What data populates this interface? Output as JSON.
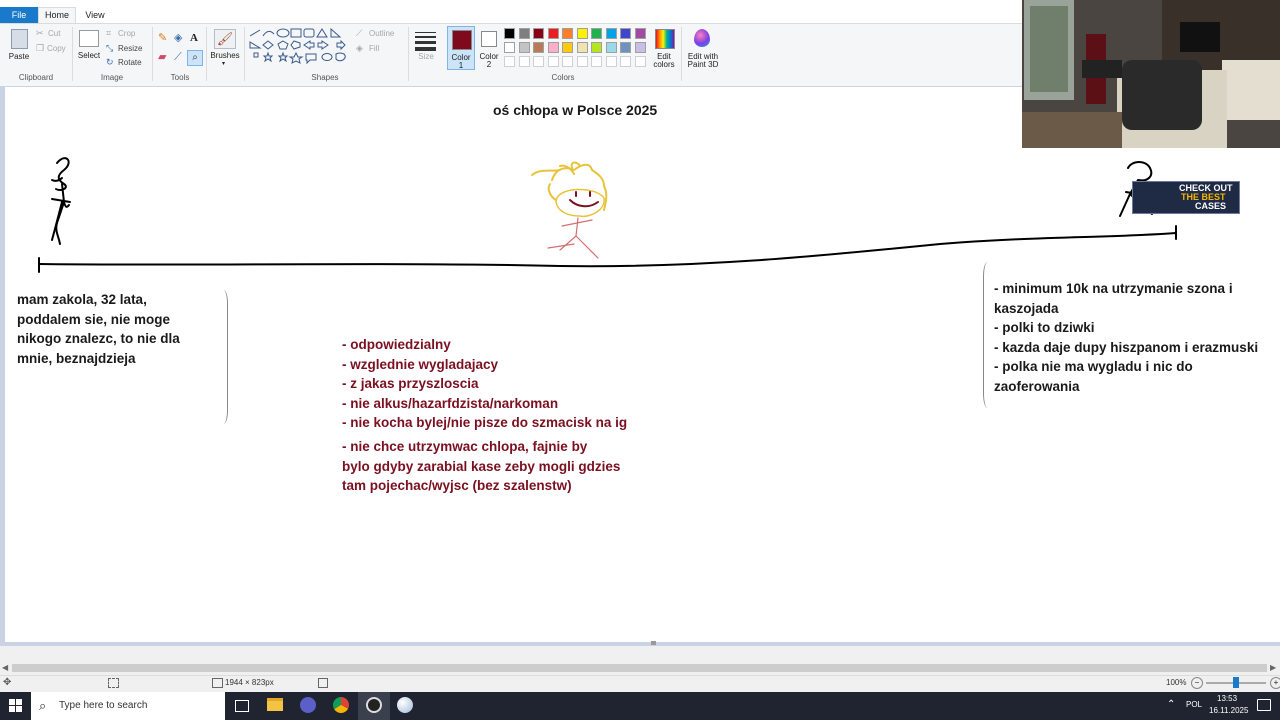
{
  "title_tabs": {
    "file": "File",
    "home": "Home",
    "view": "View"
  },
  "ribbon": {
    "clipboard": {
      "paste": "Paste",
      "cut": "Cut",
      "copy": "Copy",
      "label": "Clipboard"
    },
    "image": {
      "select": "Select",
      "crop": "Crop",
      "resize": "Resize",
      "rotate": "Rotate",
      "label": "Image"
    },
    "tools": {
      "label": "Tools"
    },
    "brushes": {
      "label": "Brushes"
    },
    "shapes": {
      "outline": "Outline",
      "fill": "Fill",
      "label": "Shapes"
    },
    "size": {
      "label": "Size"
    },
    "color1": {
      "label1": "Color",
      "label2": "1",
      "value": "#7f0a1e"
    },
    "color2": {
      "label1": "Color",
      "label2": "2",
      "value": "#ffffff"
    },
    "colors": {
      "label": "Colors"
    },
    "edit_colors": {
      "label1": "Edit",
      "label2": "colors"
    },
    "paint3d": {
      "label1": "Edit with",
      "label2": "Paint 3D"
    },
    "palette_row1": [
      "#000000",
      "#7f7f7f",
      "#880015",
      "#ed1c24",
      "#ff7f27",
      "#fff200",
      "#22b14c",
      "#00a2e8",
      "#3f48cc",
      "#a349a4"
    ],
    "palette_row2": [
      "#ffffff",
      "#c3c3c3",
      "#b97a57",
      "#ffaec9",
      "#ffc90e",
      "#efe4b0",
      "#b5e61d",
      "#99d9ea",
      "#7092be",
      "#c8bfe7"
    ]
  },
  "canvas": {
    "heading": "oś chłopa w Polsce 2025",
    "left_note": [
      "mam zakola, 32 lata,",
      "poddalem sie, nie moge",
      "nikogo znalezc, to nie dla",
      "mnie, beznajdzieja"
    ],
    "middle_note": [
      "- odpowiedzialny",
      "- wzglednie wygladajacy",
      "- z jakas przyszloscia",
      "- nie alkus/hazarfdzista/narkoman",
      "- nie kocha bylej/nie pisze do szmacisk na ig"
    ],
    "middle_note2": [
      "- nie chce utrzymwac chlopa, fajnie by",
      "bylo gdyby zarabial kase zeby mogli gdzies",
      "tam pojechac/wyjsc (bez szalenstw)"
    ],
    "right_note": [
      "- minimum 10k na utrzymanie szona i",
      "kaszojada",
      "- polki to dziwki",
      "- kazda daje dupy hiszpanom i erazmuski",
      "- polka nie ma wygladu i nic do",
      "zaoferowania"
    ],
    "ad_line1": "CHECK OUT",
    "ad_line2": "THE BEST",
    "ad_line3": "CASES"
  },
  "status": {
    "dimensions": "1944 × 823px",
    "zoom": "100%",
    "zoom_level": 0.5
  },
  "taskbar": {
    "search_placeholder": "Type here to search",
    "language": "POL",
    "time": "13:53",
    "date": "16.11.2025"
  }
}
